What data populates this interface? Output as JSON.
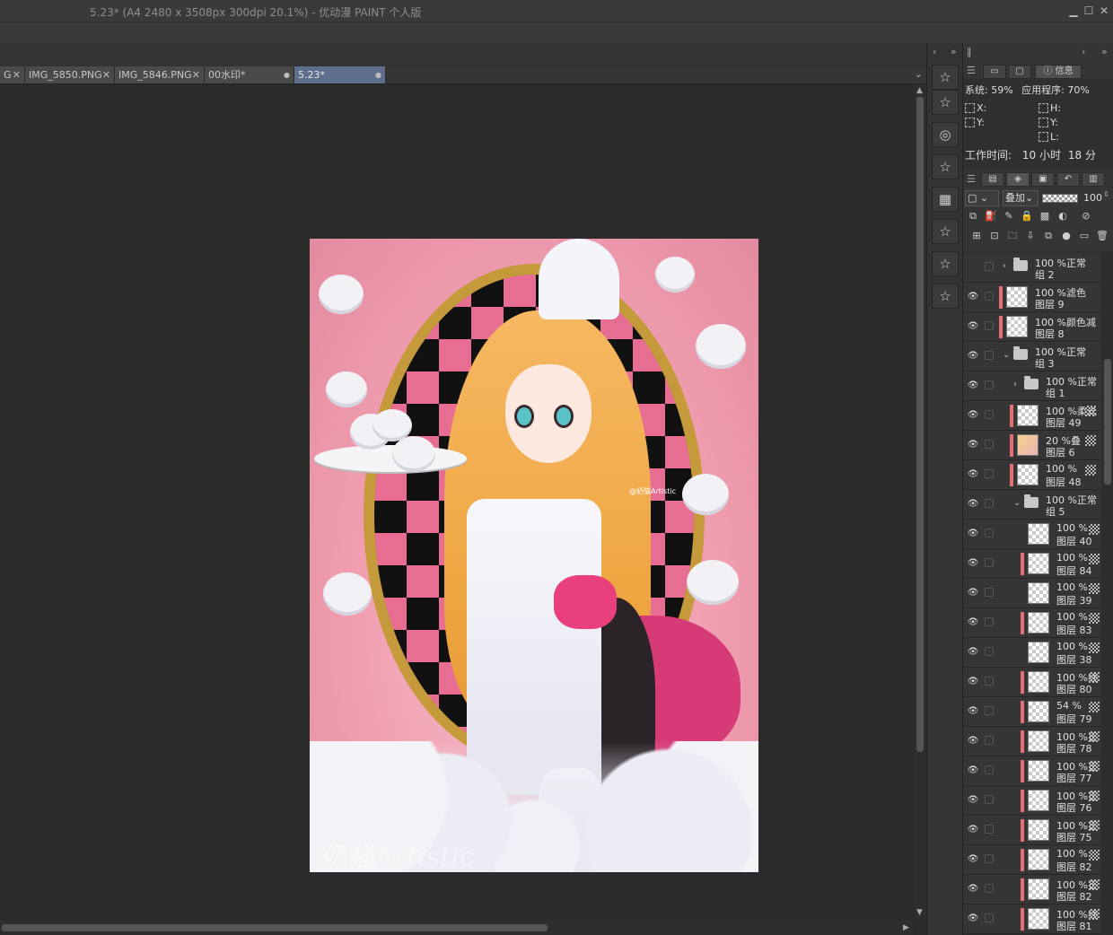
{
  "window": {
    "title": "5.23* (A4 2480 x 3508px 300dpi 20.1%)  - 优动漫 PAINT 个人版",
    "minimize": "▁",
    "maximize": "☐",
    "close": "✕"
  },
  "tabs": [
    {
      "label": "G",
      "close": "✕"
    },
    {
      "label": "IMG_5850.PNG",
      "close": "✕"
    },
    {
      "label": "IMG_5846.PNG",
      "close": "✕"
    },
    {
      "label": "00水印*",
      "close": "●"
    },
    {
      "label": "5.23*",
      "close": "●",
      "active": true
    }
  ],
  "tabs_more": "⌄",
  "artwork": {
    "watermark": "奶猫Artistic",
    "signature": "@奶猫Artistic"
  },
  "panel_nav": {
    "left": "‹",
    "collapse": "»",
    "right": "›",
    "expand": "»"
  },
  "info_tabs": [
    "",
    "",
    "信息"
  ],
  "info": {
    "system_label": "系统:",
    "system_value": "59%",
    "app_label": "应用程序:",
    "app_value": "70%",
    "x_label": "X:",
    "y_label": "Y:",
    "h_label": "H:",
    "v_label": "Y:",
    "l_label": "L:",
    "work_time_label": "工作时间:",
    "work_time_hours": "10",
    "hours_unit": "小时",
    "work_time_minutes": "18",
    "minutes_unit": "分"
  },
  "layer_panel": {
    "blend_mode": "叠加",
    "opacity": "100"
  },
  "layers": [
    {
      "opacity": "100",
      "mode": "%正常",
      "name": "组 2",
      "type": "folder",
      "visible": false,
      "indent": 0,
      "chevron": "›"
    },
    {
      "opacity": "100",
      "mode": "%滤色",
      "name": "图层 9",
      "type": "layer",
      "visible": true,
      "indent": 0,
      "marked": true
    },
    {
      "opacity": "100",
      "mode": "%颜色减",
      "name": "图层 8",
      "type": "layer",
      "visible": true,
      "indent": 0,
      "marked": true
    },
    {
      "opacity": "100",
      "mode": "%正常",
      "name": "组 3",
      "type": "folder",
      "visible": true,
      "indent": 0,
      "chevron": "⌄"
    },
    {
      "opacity": "100",
      "mode": "%正常",
      "name": "组 1",
      "type": "folder",
      "visible": true,
      "indent": 1,
      "chevron": "›"
    },
    {
      "opacity": "100",
      "mode": "%柔光",
      "name": "图层 49",
      "type": "layer",
      "visible": true,
      "indent": 1,
      "marked": true
    },
    {
      "opacity": "20",
      "mode": "%叠",
      "name": "图层 6",
      "type": "pic",
      "visible": true,
      "indent": 1,
      "marked": true
    },
    {
      "opacity": "100",
      "mode": "%",
      "name": "图层 48",
      "type": "layer",
      "visible": true,
      "indent": 1,
      "marked": true
    },
    {
      "opacity": "100",
      "mode": "%正常",
      "name": "组 5",
      "type": "folder",
      "visible": true,
      "indent": 1,
      "chevron": "⌄"
    },
    {
      "opacity": "100",
      "mode": "%",
      "name": "图层 40",
      "type": "layer",
      "visible": true,
      "indent": 2
    },
    {
      "opacity": "100",
      "mode": "%",
      "name": "图层 84",
      "type": "layer",
      "visible": true,
      "indent": 2,
      "marked": true
    },
    {
      "opacity": "100",
      "mode": "%",
      "name": "图层 39",
      "type": "layer",
      "visible": true,
      "indent": 2
    },
    {
      "opacity": "100",
      "mode": "%",
      "name": "图层 83",
      "type": "layer",
      "visible": true,
      "indent": 2,
      "marked": true
    },
    {
      "opacity": "100",
      "mode": "%",
      "name": "图层 38",
      "type": "layer",
      "visible": true,
      "indent": 2
    },
    {
      "opacity": "100",
      "mode": "%线",
      "name": "图层 80",
      "type": "layer",
      "visible": true,
      "indent": 2,
      "marked": true
    },
    {
      "opacity": "54",
      "mode": "%",
      "name": "图层 79",
      "type": "layer",
      "visible": true,
      "indent": 2,
      "marked": true
    },
    {
      "opacity": "100",
      "mode": "%正",
      "name": "图层 78",
      "type": "layer",
      "visible": true,
      "indent": 2,
      "marked": true
    },
    {
      "opacity": "100",
      "mode": "%正",
      "name": "图层 77",
      "type": "layer",
      "visible": true,
      "indent": 2,
      "marked": true
    },
    {
      "opacity": "100",
      "mode": "%正",
      "name": "图层 76",
      "type": "layer",
      "visible": true,
      "indent": 2,
      "marked": true
    },
    {
      "opacity": "100",
      "mode": "%正",
      "name": "图层 75",
      "type": "layer",
      "visible": true,
      "indent": 2,
      "marked": true
    },
    {
      "opacity": "100",
      "mode": "%",
      "name": "图层 82",
      "type": "layer",
      "visible": true,
      "indent": 2,
      "marked": true
    },
    {
      "opacity": "100",
      "mode": "%正",
      "name": "图层 82",
      "type": "layer",
      "visible": true,
      "indent": 2,
      "marked": true
    },
    {
      "opacity": "100",
      "mode": "%线",
      "name": "图层 81",
      "type": "layer",
      "visible": true,
      "indent": 2,
      "marked": true
    }
  ],
  "colors": {
    "active_tab": "#5e6f8e",
    "layer_mark": "#e86d74"
  }
}
